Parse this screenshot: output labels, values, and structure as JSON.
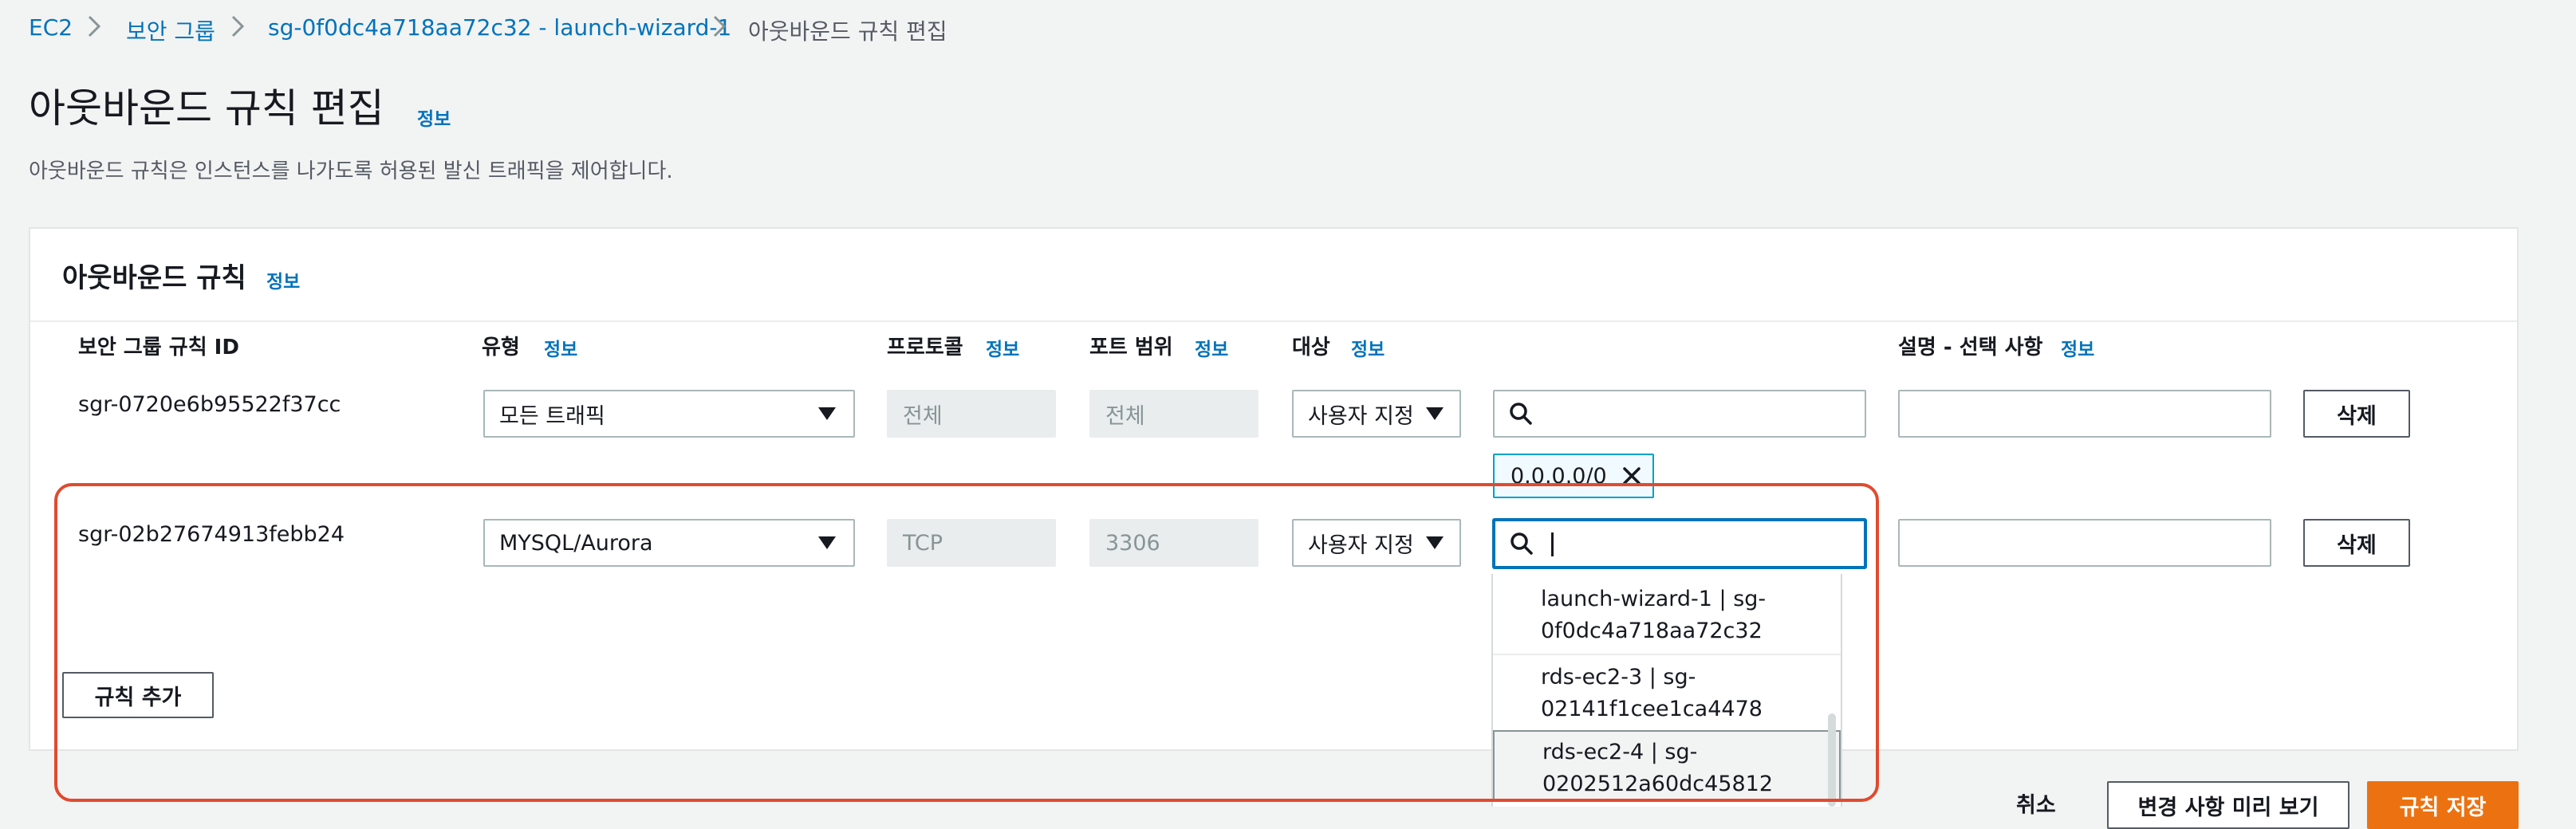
{
  "breadcrumb": {
    "items": [
      "EC2",
      "보안 그룹",
      "sg-0f0dc4a718aa72c32 - launch-wizard-1",
      "아웃바운드 규칙 편집"
    ]
  },
  "page": {
    "title": "아웃바운드 규칙 편집",
    "info": "정보",
    "description": "아웃바운드 규칙은 인스턴스를 나가도록 허용된 발신 트래픽을 제어합니다."
  },
  "panel": {
    "title": "아웃바운드 규칙",
    "info": "정보",
    "columns": {
      "rule_id": "보안 그룹 규칙 ID",
      "type": "유형",
      "protocol": "프로토콜",
      "port_range": "포트 범위",
      "destination": "대상",
      "description": "설명 - 선택 사항",
      "info": "정보"
    },
    "rows": [
      {
        "rule_id": "sgr-0720e6b95522f37cc",
        "type": "모든 트래픽",
        "protocol": "전체",
        "port": "전체",
        "dest_mode": "사용자 지정",
        "search_value": "",
        "token": "0.0.0.0/0",
        "desc_value": "",
        "delete": "삭제"
      },
      {
        "rule_id": "sgr-02b27674913febb24",
        "type": "MYSQL/Aurora",
        "protocol": "TCP",
        "port": "3306",
        "dest_mode": "사용자 지정",
        "search_value": "",
        "desc_value": "",
        "delete": "삭제"
      }
    ],
    "add_rule": "규칙 추가"
  },
  "dropdown": {
    "options": [
      {
        "line1": "launch-wizard-1 | sg-",
        "line2": "0f0dc4a718aa72c32"
      },
      {
        "line1": "rds-ec2-3 | sg-",
        "line2": "02141f1cee1ca4478"
      },
      {
        "line1": "rds-ec2-4 | sg-",
        "line2": "0202512a60dc45812"
      }
    ]
  },
  "footer": {
    "cancel": "취소",
    "preview": "변경 사항 미리 보기",
    "save": "규칙 저장"
  },
  "colors": {
    "link": "#0073bb",
    "primary": "#ec7211",
    "highlight": "#e04b2f",
    "focus": "#0073bb"
  },
  "icons": [
    "chevron-right-icon",
    "search-icon",
    "close-icon",
    "caret-down-icon"
  ]
}
